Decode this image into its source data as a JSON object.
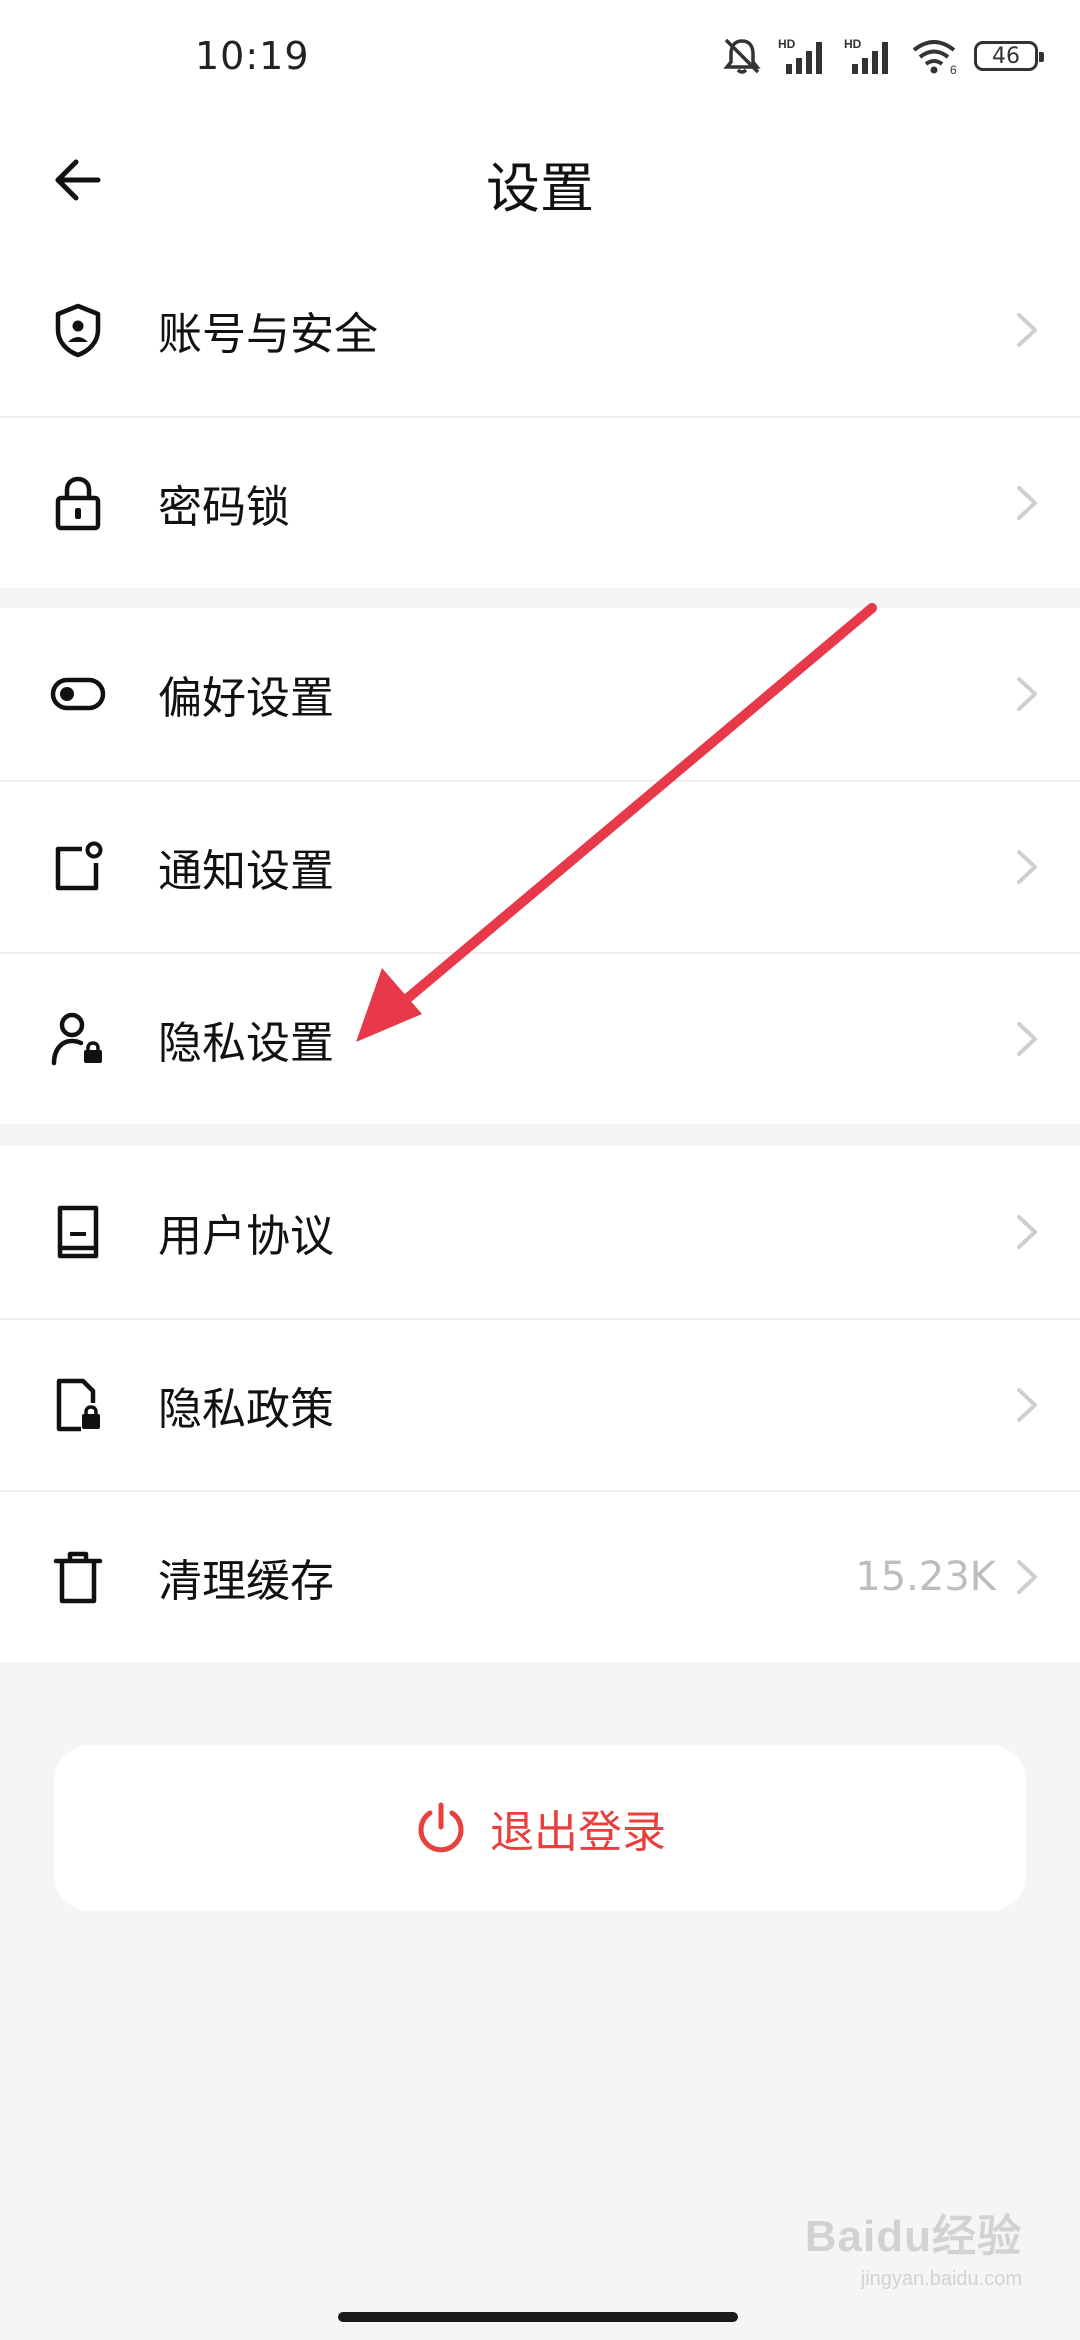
{
  "status_bar": {
    "time": "10:19",
    "battery": "46",
    "icons": [
      "mute-bell-icon",
      "hd-signal-icon",
      "hd-signal-icon",
      "wifi-icon",
      "battery-icon"
    ]
  },
  "header": {
    "title": "设置",
    "back_icon": "arrow-left-icon"
  },
  "groups": [
    {
      "items": [
        {
          "label": "账号与安全",
          "icon": "shield-user-icon"
        },
        {
          "label": "密码锁",
          "icon": "lock-icon"
        }
      ]
    },
    {
      "items": [
        {
          "label": "偏好设置",
          "icon": "toggle-icon"
        },
        {
          "label": "通知设置",
          "icon": "notification-icon"
        },
        {
          "label": "隐私设置",
          "icon": "user-lock-icon"
        }
      ]
    },
    {
      "items": [
        {
          "label": "用户协议",
          "icon": "book-icon"
        },
        {
          "label": "隐私政策",
          "icon": "document-lock-icon"
        },
        {
          "label": "清理缓存",
          "icon": "trash-icon",
          "value": "15.23K"
        }
      ]
    }
  ],
  "logout": {
    "label": "退出登录",
    "icon": "power-icon"
  },
  "watermark": {
    "brand": "Baidu经验",
    "url": "jingyan.baidu.com"
  },
  "colors": {
    "accent_red": "#e8403d",
    "annotation_arrow": "#e8394b",
    "background": "#f5f5f5",
    "card": "#ffffff",
    "value_gray": "#bdbdbd"
  }
}
